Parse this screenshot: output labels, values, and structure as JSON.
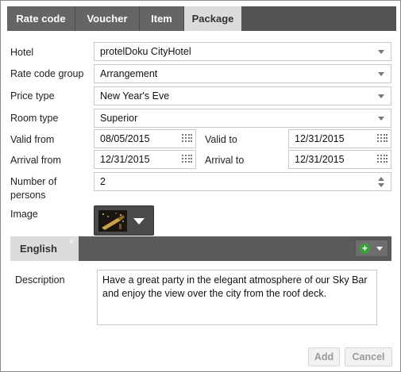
{
  "tabs": [
    "Rate code",
    "Voucher",
    "Item",
    "Package"
  ],
  "active_tab": "Package",
  "form": {
    "hotel": {
      "label": "Hotel",
      "value": "protelDoku CityHotel"
    },
    "rate_code_group": {
      "label": "Rate code group",
      "value": "Arrangement"
    },
    "price_type": {
      "label": "Price type",
      "value": "New Year's Eve"
    },
    "room_type": {
      "label": "Room type",
      "value": "Superior"
    },
    "valid_from": {
      "label": "Valid from",
      "value": "08/05/2015"
    },
    "valid_to": {
      "label": "Valid to",
      "value": "12/31/2015"
    },
    "arrival_from": {
      "label": "Arrival from",
      "value": "12/31/2015"
    },
    "arrival_to": {
      "label": "Arrival to",
      "value": "12/31/2015"
    },
    "number_of_persons": {
      "label_line1": "Number of",
      "label_line2": "persons",
      "value": "2"
    },
    "image": {
      "label": "Image"
    }
  },
  "language": {
    "tab_label": "English",
    "close_symbol": "×",
    "add_symbol": "+"
  },
  "description": {
    "label": "Description",
    "value": "Have a great party in the elegant atmosphere of our Sky Bar and enjoy the view over the city from the roof deck."
  },
  "buttons": {
    "add": "Add",
    "cancel": "Cancel"
  },
  "icons": {
    "dropdown": "chevron-down-icon",
    "calendar": "calendar-icon",
    "spinner": "spinner-arrows-icon",
    "add_language": "plus-circle-icon"
  },
  "colors": {
    "tab_bar": "#535353",
    "active_tab": "#dcdcdc",
    "add_icon": "#3aa13a"
  }
}
